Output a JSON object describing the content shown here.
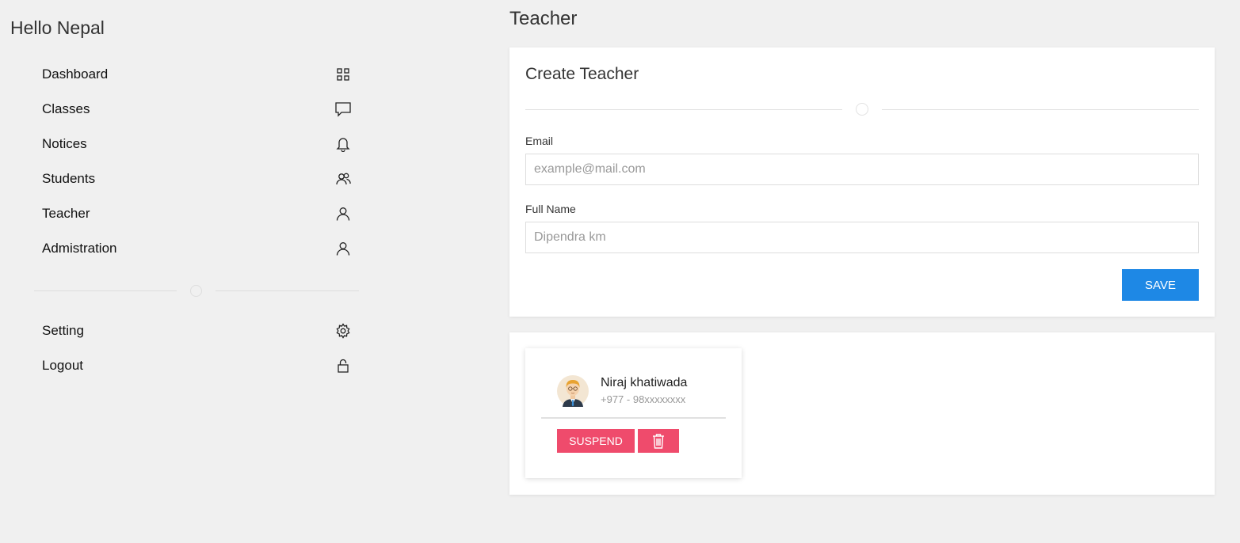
{
  "sidebar": {
    "brand": "Hello Nepal",
    "items": [
      {
        "label": "Dashboard",
        "icon": "grid-icon"
      },
      {
        "label": "Classes",
        "icon": "chat-icon"
      },
      {
        "label": "Notices",
        "icon": "bell-icon"
      },
      {
        "label": "Students",
        "icon": "users-icon"
      },
      {
        "label": "Teacher",
        "icon": "user-icon"
      },
      {
        "label": "Admistration",
        "icon": "user-icon"
      }
    ],
    "bottom_items": [
      {
        "label": "Setting",
        "icon": "gear-icon"
      },
      {
        "label": "Logout",
        "icon": "lock-icon"
      }
    ]
  },
  "main": {
    "title": "Teacher",
    "form": {
      "title": "Create Teacher",
      "email_label": "Email",
      "email_placeholder": "example@mail.com",
      "name_label": "Full Name",
      "name_placeholder": "Dipendra km",
      "save_label": "SAVE"
    },
    "teachers": [
      {
        "name": "Niraj khatiwada",
        "phone": "+977 - 98xxxxxxxx",
        "suspend_label": "SUSPEND"
      }
    ]
  },
  "colors": {
    "primary": "#1e88e5",
    "danger": "#ef4b6c",
    "background": "#f0f0f0"
  }
}
